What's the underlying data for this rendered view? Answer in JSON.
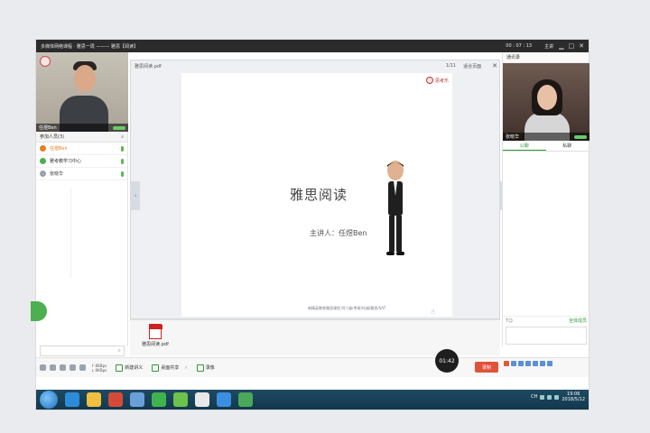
{
  "window": {
    "title": "多媒体网络课程 · 雅思一周 ——— 雅思【阅读】",
    "clock": "00 : 07 : 13",
    "user_label": "主讲"
  },
  "left_panel": {
    "teacher_cam_name": "任煜Ben",
    "participants_header": "参加人员(3)",
    "participants": [
      {
        "label": "任煜Ben",
        "active": true,
        "icon_color": "#e67e22"
      },
      {
        "label": "雅考教学习中心",
        "active": false,
        "icon_color": "#4caf50"
      },
      {
        "label": "张晓华",
        "active": false,
        "icon_color": "#9aa3ad"
      }
    ]
  },
  "slide_area": {
    "file_name": "雅思阅读.pdf",
    "page_indicator": "1/11",
    "fit_label": "适合页面",
    "brand_text": "思考乐",
    "title": "雅思阅读",
    "speaker": "主讲人：任煜Ben",
    "footer": "新精英教育雅思课程 四六级/考研/托福/雅思/SAT"
  },
  "files": [
    {
      "name": "雅思阅读.pdf"
    }
  ],
  "right_panel": {
    "header": "通讯录",
    "student_cam_name": "张晓华",
    "tabs": [
      {
        "label": "公聊",
        "active": true
      },
      {
        "label": "私聊",
        "active": false
      }
    ],
    "chat_tools_left": "T☺",
    "chat_tools_right": "全体成员"
  },
  "toolbar": {
    "speed_up": "↑:0KBps",
    "speed_down": "↓:0KBps",
    "new_lecture": "新建讲义",
    "share_screen": "桌面共享",
    "flash_icon": "⚡",
    "recording": "录像",
    "timer": "01:42",
    "rec_label": "录制"
  },
  "taskbar": {
    "time": "19:06",
    "date": "2018/5/12",
    "lang": "CH",
    "apps": [
      {
        "name": "ie-icon",
        "color": "#2e8bd8"
      },
      {
        "name": "folder-icon",
        "color": "#f0c040"
      },
      {
        "name": "app-red-icon",
        "color": "#d64a3a"
      },
      {
        "name": "notes-icon",
        "color": "#6aa0d8"
      },
      {
        "name": "wechat-icon",
        "color": "#3fb34f"
      },
      {
        "name": "media-icon",
        "color": "#6cc24a"
      },
      {
        "name": "chrome-icon",
        "color": "#e8e8e8"
      },
      {
        "name": "qq-icon",
        "color": "#3c8fe0"
      },
      {
        "name": "class-app-icon",
        "color": "#4aa85a"
      }
    ]
  }
}
